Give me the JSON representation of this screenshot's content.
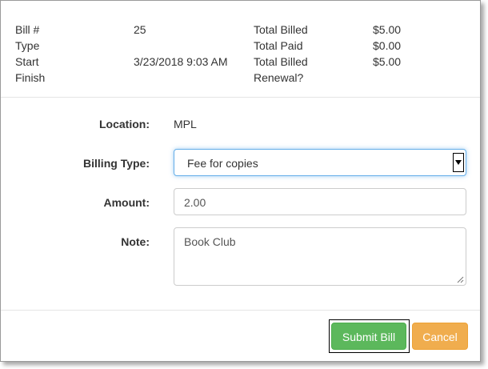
{
  "summary": {
    "bill_number_label": "Bill #",
    "bill_number_value": "25",
    "type_label": "Type",
    "type_value": "",
    "start_label": "Start",
    "start_value": "3/23/2018 9:03 AM",
    "finish_label": "Finish",
    "finish_value": "",
    "total_billed_label": "Total Billed",
    "total_billed_value": "$5.00",
    "total_paid_label": "Total Paid",
    "total_paid_value": "$0.00",
    "total_billed_renewal_label_line1": "Total Billed",
    "total_billed_renewal_label_line2": "Renewal?",
    "total_billed_renewal_value": "$5.00"
  },
  "form": {
    "location_label": "Location:",
    "location_value": "MPL",
    "billing_type_label": "Billing Type:",
    "billing_type_selected": "Fee for copies",
    "amount_label": "Amount:",
    "amount_value": "2.00",
    "note_label": "Note:",
    "note_value": "Book Club"
  },
  "buttons": {
    "submit_label": "Submit Bill",
    "cancel_label": "Cancel"
  },
  "colors": {
    "submit": "#5cb85c",
    "cancel": "#f0ad4e",
    "focus_border": "#66afe9"
  },
  "icons": {
    "select_arrow": "caret-down-icon",
    "textarea_resize": "resize-grip-icon"
  }
}
